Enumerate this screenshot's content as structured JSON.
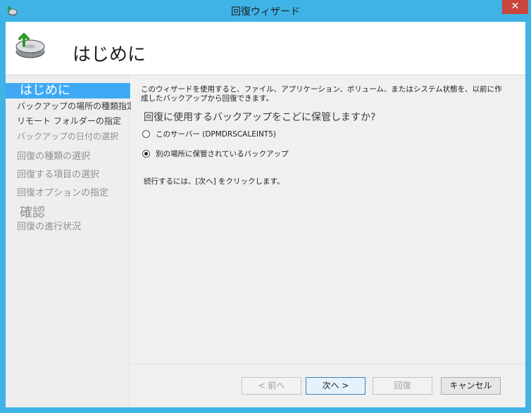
{
  "window": {
    "title": "回復ウィザード",
    "close_label": "✕"
  },
  "header": {
    "title": "はじめに"
  },
  "nav": {
    "items": [
      {
        "label": "はじめに"
      },
      {
        "label": "バックアップの場所の種類指定"
      },
      {
        "label": "リモート フォルダーの指定"
      },
      {
        "label": "バックアップの日付の選択"
      },
      {
        "label": "回復の種類の選択"
      },
      {
        "label": "回復する項目の選択"
      },
      {
        "label": "回復オプションの指定"
      },
      {
        "label": "確認"
      },
      {
        "label": "回復の進行状況"
      }
    ]
  },
  "content": {
    "intro": "このウィザードを使用すると、ファイル、アプリケーション、ボリューム、またはシステム状態を、以前に作成したバックアップから回復できます。",
    "question": "回復に使用するバックアップをこどに保管しますか?",
    "option_1": "このサーバー (DPMDRSCALEINT5)",
    "option_2": "別の場所に保管されているバックアップ",
    "hint": "続行するには、[次へ] をクリックします。"
  },
  "footer": {
    "prev_label": "< 前へ",
    "next_label": "次へ >",
    "recover_label": "回復",
    "cancel_label": "キャンセル"
  },
  "colors": {
    "accent": "#3fa9f5",
    "frame": "#3fb3e6",
    "close": "#c8463d"
  },
  "icons": {
    "title_icon": "backup-recovery-icon",
    "header_icon": "backup-disk-arrow-icon"
  }
}
